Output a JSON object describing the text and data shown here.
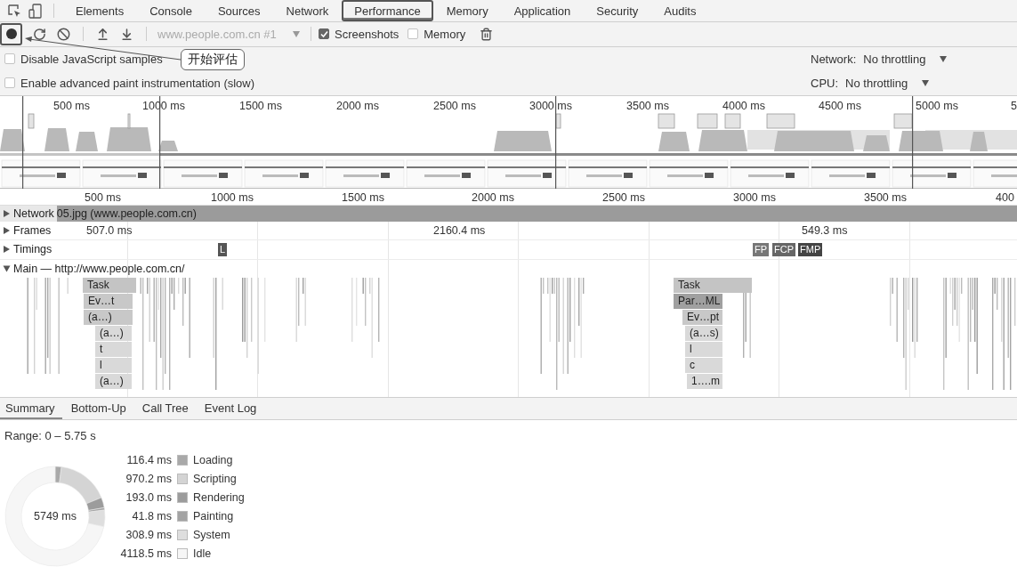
{
  "tabs": [
    {
      "label": "Elements",
      "selected": false
    },
    {
      "label": "Console",
      "selected": false
    },
    {
      "label": "Sources",
      "selected": false
    },
    {
      "label": "Network",
      "selected": false
    },
    {
      "label": "Performance",
      "selected": true
    },
    {
      "label": "Memory",
      "selected": false
    },
    {
      "label": "Application",
      "selected": false
    },
    {
      "label": "Security",
      "selected": false
    },
    {
      "label": "Audits",
      "selected": false
    }
  ],
  "toolbar": {
    "url": "www.people.com.cn #1",
    "options": [
      {
        "label": "Screenshots",
        "checked": true
      },
      {
        "label": "Memory",
        "checked": false
      }
    ]
  },
  "callout": "开始评估",
  "settings": [
    {
      "label": "Disable JavaScript samples",
      "checked": false,
      "throttle_label": "Network:",
      "throttle_value": "No throttling"
    },
    {
      "label": "Enable advanced paint instrumentation (slow)",
      "checked": false,
      "throttle_label": "CPU:",
      "throttle_value": "No throttling"
    }
  ],
  "overview": {
    "ticks": [
      "500 ms",
      "1000 ms",
      "1500 ms",
      "2000 ms",
      "2500 ms",
      "3000 ms",
      "3500 ms",
      "4000 ms",
      "4500 ms",
      "5000 ms",
      "5"
    ]
  },
  "ruler": {
    "ticks": [
      "500 ms",
      "1000 ms",
      "1500 ms",
      "2000 ms",
      "2500 ms",
      "3000 ms",
      "3500 ms",
      "400"
    ]
  },
  "tracks": [
    {
      "kind": "network",
      "label": "Network",
      "expanded": false,
      "request": "05.jpg (www.people.com.cn)"
    },
    {
      "kind": "frames",
      "label": "Frames",
      "expanded": false,
      "durations": [
        "507.0 ms",
        "2160.4 ms",
        "549.3 ms"
      ]
    },
    {
      "kind": "timings",
      "label": "Timings",
      "expanded": false,
      "markers": [
        {
          "label": "L",
          "color": "#555555"
        },
        {
          "label": "FP",
          "color": "#777777"
        },
        {
          "label": "FCP",
          "color": "#666666"
        },
        {
          "label": "FMP",
          "color": "#444444"
        }
      ]
    }
  ],
  "main": {
    "label": "Main — http://www.people.com.cn/",
    "expanded": true,
    "stacks": [
      [
        "Task",
        "Ev…t",
        "(a…)",
        "(a…)",
        "t",
        "l",
        "(a…)"
      ],
      [
        "Task",
        "Par…ML",
        "Ev…pt",
        "(a…s)",
        "l",
        "c",
        "1….m"
      ]
    ]
  },
  "bottom_tabs": [
    {
      "label": "Summary",
      "selected": true
    },
    {
      "label": "Bottom-Up",
      "selected": false
    },
    {
      "label": "Call Tree",
      "selected": false
    },
    {
      "label": "Event Log",
      "selected": false
    }
  ],
  "summary": {
    "range": "Range: 0 – 5.75 s",
    "total": "5749 ms",
    "legend": [
      {
        "value": "116.4 ms",
        "color": "#a9a9a9"
      },
      {
        "value": "970.2 ms",
        "color": "#d4d4d4"
      },
      {
        "value": "193.0 ms",
        "color": "#9c9c9c"
      },
      {
        "value": "41.8 ms",
        "color": "#a3a3a3"
      },
      {
        "value": "308.9 ms",
        "color": "#dedede"
      },
      {
        "value": "4118.5 ms",
        "color": "#f6f6f6"
      }
    ],
    "chart_data": {
      "type": "donut",
      "categories": [
        "Loading",
        "Scripting",
        "Rendering",
        "Painting",
        "System",
        "Idle"
      ],
      "values": [
        2.02,
        16.88,
        3.36,
        0.73,
        5.37,
        71.64
      ]
    }
  }
}
